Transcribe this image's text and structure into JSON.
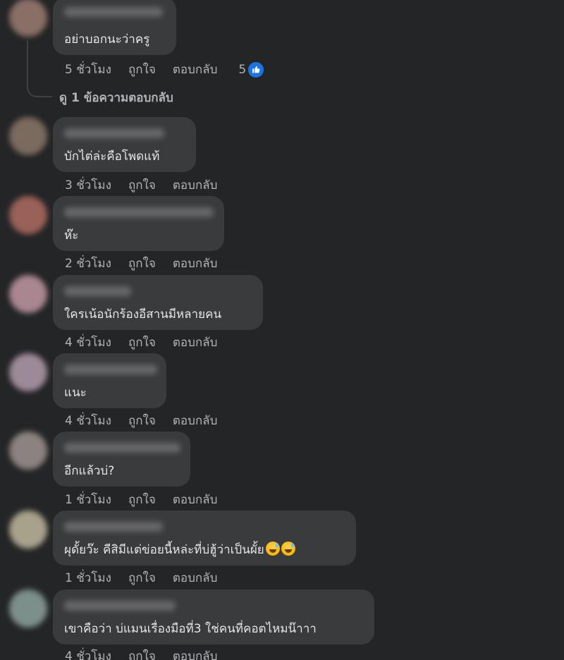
{
  "labels": {
    "like": "ถูกใจ",
    "reply": "ตอบกลับ",
    "view_replies": "ดู 1 ข้อความตอบกลับ"
  },
  "comments": [
    {
      "text": "อย่าบอกนะว่าครู",
      "time": "5 ชั่วโมง",
      "reactions": "5"
    },
    {
      "text": "บักไต่ล่ะคือโพดแท้",
      "time": "3 ชั่วโมง"
    },
    {
      "text": "ห๊ะ",
      "time": "2 ชั่วโมง"
    },
    {
      "text": "ใครเน้อนักร้องอีสานมีหลายคน",
      "time": "4 ชั่วโมง"
    },
    {
      "text": "แนะ",
      "time": "4 ชั่วโมง"
    },
    {
      "text": "อีกแล้วบ่?",
      "time": "1 ชั่วโมง"
    },
    {
      "text": "ผุดั้ยว๊ะ คีสิมีแต่ข่อยนี้หล่ะที่บ่ฮู้ว่าเป็นผั้ย",
      "time": "1 ชั่วโมง",
      "emoji": "grinning-sweat-emoji"
    },
    {
      "text": "เขาคือว่า บ่แมนเรื่องมือที่3 ใช่คนที่คอตไหมน๊าาา",
      "time": "4 ชั่วโมง"
    }
  ],
  "colors": {
    "background": "#242526",
    "bubble": "#3a3b3c",
    "text": "#e4e6eb",
    "secondary_text": "#b0b3b8",
    "like_blue": "#1b74e4"
  }
}
